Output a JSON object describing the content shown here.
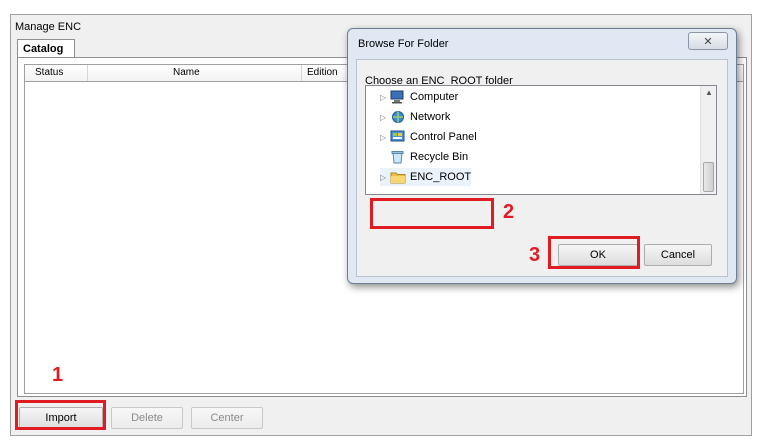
{
  "main": {
    "title": "Manage ENC",
    "tab_label": "Catalog",
    "columns": [
      "Status",
      "Name",
      "Edition"
    ],
    "buttons": {
      "import": "Import",
      "delete": "Delete",
      "center": "Center"
    }
  },
  "dialog": {
    "title": "Browse For Folder",
    "close_glyph": "✕",
    "prompt": "Choose an ENC_ROOT folder",
    "tree_items": [
      "Computer",
      "Network",
      "Control Panel",
      "Recycle Bin",
      "ENC_ROOT"
    ],
    "ok": "OK",
    "cancel": "Cancel"
  },
  "annotations": [
    "1",
    "2",
    "3"
  ],
  "icons": {
    "computer": "computer-icon",
    "network": "network-icon",
    "control_panel": "control-panel-icon",
    "recycle_bin": "recycle-bin-icon",
    "folder": "folder-icon"
  },
  "colors": {
    "annotation_red": "#e11b22",
    "folder_yellow": "#e8c04a"
  }
}
